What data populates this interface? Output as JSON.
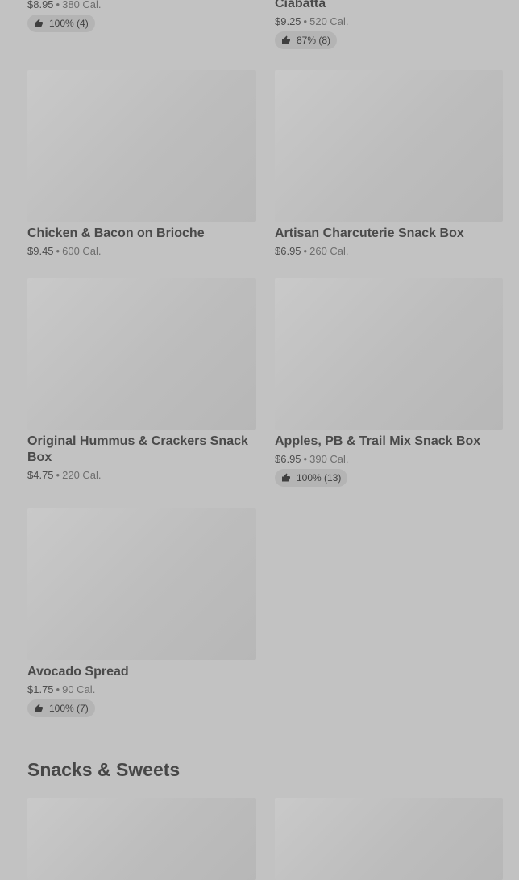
{
  "items": [
    {
      "name": "",
      "price": "$8.95",
      "cal": "380 Cal.",
      "rating": "100% (4)"
    },
    {
      "name": "Ciabatta",
      "price": "$9.25",
      "cal": "520 Cal.",
      "rating": "87% (8)"
    },
    {
      "name": "Chicken & Bacon on Brioche",
      "price": "$9.45",
      "cal": "600 Cal.",
      "rating": ""
    },
    {
      "name": "Artisan Charcuterie Snack Box",
      "price": "$6.95",
      "cal": "260 Cal.",
      "rating": ""
    },
    {
      "name": "Original Hummus & Crackers Snack Box",
      "price": "$4.75",
      "cal": "220 Cal.",
      "rating": ""
    },
    {
      "name": "Apples, PB & Trail Mix Snack Box",
      "price": "$6.95",
      "cal": "390 Cal.",
      "rating": "100% (13)"
    },
    {
      "name": "Avocado Spread",
      "price": "$1.75",
      "cal": "90 Cal.",
      "rating": "100% (7)"
    }
  ],
  "sections": {
    "snacks_title": "Snacks & Sweets"
  },
  "icons": {
    "rating": "thumbs-up-icon"
  }
}
